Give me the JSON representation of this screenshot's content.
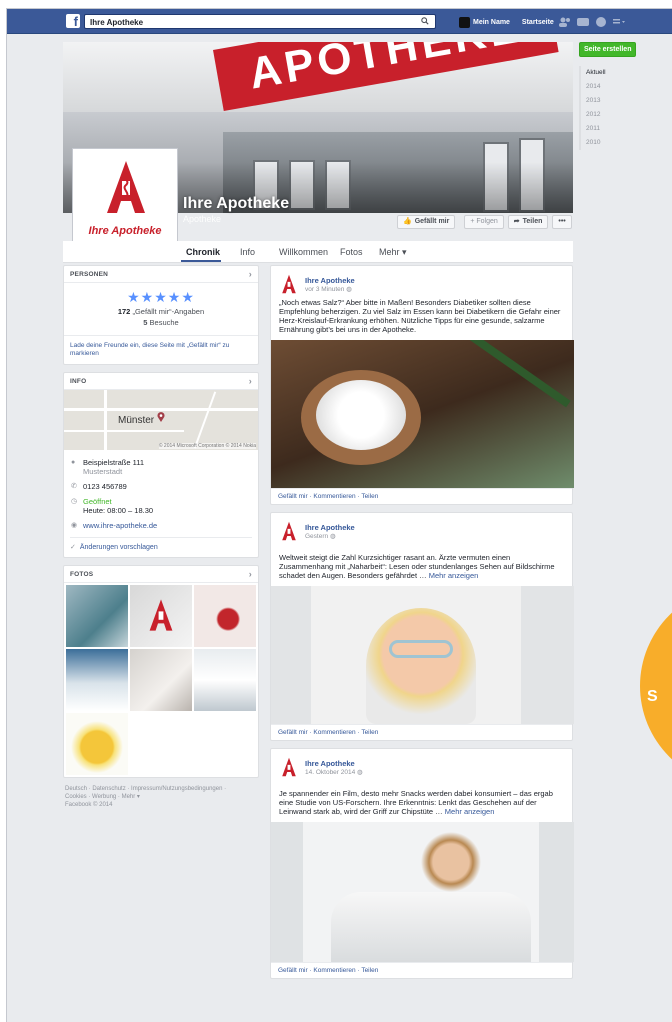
{
  "topbar": {
    "search_value": "Ihre Apotheke",
    "user_name": "Mein Name",
    "home_label": "Startseite"
  },
  "cover": {
    "banner_text": "APOTHEKE",
    "page_name": "Ihre Apotheke",
    "page_category": "Apotheke",
    "profile_label": "Ihre Apotheke",
    "like_button": "Gefällt mir",
    "follow_button": "+ Folgen",
    "share_button": "Teilen",
    "more_button": "•••"
  },
  "tabs": [
    {
      "label": "Chronik",
      "active": true
    },
    {
      "label": "Info"
    },
    {
      "label": "Willkommen"
    },
    {
      "label": "Fotos"
    },
    {
      "label": "Mehr ▾"
    }
  ],
  "right_rail": {
    "create_page": "Seite erstellen",
    "years": [
      "Aktuell",
      "2014",
      "2013",
      "2012",
      "2011",
      "2010"
    ]
  },
  "people_card": {
    "heading": "PERSONEN",
    "stars": "★★★★★",
    "likes_count": "172",
    "likes_label": "„Gefällt mir“-Angaben",
    "visits_count": "5",
    "visits_label": "Besuche",
    "invite_text": "Lade deine Freunde ein, diese Seite mit „Gefällt mir“ zu markieren"
  },
  "info_card": {
    "heading": "INFO",
    "map_city": "Münster",
    "map_copyright": "© 2014 Microsoft Corporation © 2014 Nokia",
    "street": "Beispielstraße 111",
    "city": "Musterstadt",
    "phone": "0123 456789",
    "open_status": "Geöffnet",
    "hours": "Heute: 08:00 – 18.30",
    "website": "www.ihre-apotheke.de",
    "suggest": "Änderungen vorschlagen"
  },
  "photos_card": {
    "heading": "FOTOS"
  },
  "footer": {
    "line1": "Deutsch · Datenschutz · Impressum/Nutzungsbedingungen ·",
    "line2": "Cookies · Werbung · Mehr ▾",
    "line3": "Facebook © 2014"
  },
  "posts": [
    {
      "author": "Ihre Apotheke",
      "time": "vor 3 Minuten",
      "text": "„Noch etwas Salz?“ Aber bitte in Maßen! Besonders Diabetiker sollten diese Empfehlung beherzigen. Zu viel Salz im Essen kann bei Diabetikern die Gefahr einer Herz-Kreislauf-Erkrankung erhöhen. Nützliche Tipps für eine gesunde, salzarme Ernährung gibt’s bei uns in der Apotheke.",
      "more": "",
      "actions": "Gefällt mir · Kommentieren · Teilen"
    },
    {
      "author": "Ihre Apotheke",
      "time": "Gestern",
      "text": "Weltweit steigt die Zahl Kurzsichtiger rasant an. Ärzte vermuten einen Zusammenhang mit „Naharbeit“: Lesen oder stundenlanges Sehen auf Bildschirme schadet den Augen. Besonders gefährdet …",
      "more": "Mehr anzeigen",
      "actions": "Gefällt mir · Kommentieren · Teilen"
    },
    {
      "author": "Ihre Apotheke",
      "time": "14. Oktober 2014",
      "text": "Je spannender ein Film, desto mehr Snacks werden dabei konsumiert – das ergab eine Studie von US-Forschern. Ihre Erkenntnis: Lenkt das Geschehen auf der Leinwand stark ab, wird der Griff zur Chipstüte …",
      "more": "Mehr anzeigen",
      "actions": "Gefällt mir · Kommentieren · Teilen"
    }
  ],
  "side_badge": "S",
  "colors": {
    "facebook_blue": "#3b5998",
    "link_blue": "#365899",
    "pharmacy_red": "#c8202b",
    "create_green": "#42b72a",
    "badge_orange": "#f8ad2a"
  }
}
